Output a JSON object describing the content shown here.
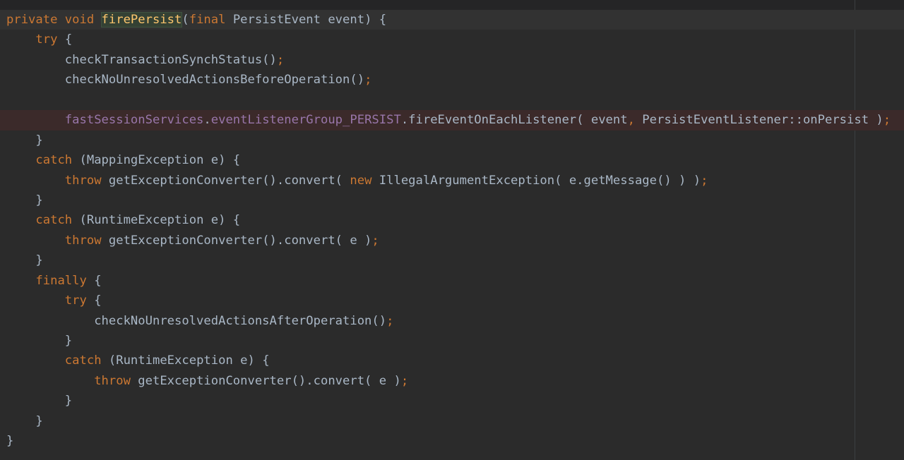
{
  "editor": {
    "colors": {
      "background": "#2b2b2b",
      "keyword": "#cc7832",
      "method_declaration": "#ffc66d",
      "field": "#9876aa",
      "plain": "#a9b7c6",
      "breakpoint_line": "#3b2a2a"
    },
    "lines": [
      {
        "indent": "",
        "tokens": [
          {
            "cls": "kw",
            "text": "private void "
          },
          {
            "cls": "caret",
            "text": ""
          },
          {
            "cls": "fn decl-hl",
            "text": "firePersist"
          },
          {
            "cls": "",
            "text": "("
          },
          {
            "cls": "kw",
            "text": "final "
          },
          {
            "cls": "",
            "text": "PersistEvent event) {"
          }
        ]
      },
      {
        "indent": "    ",
        "tokens": [
          {
            "cls": "kw",
            "text": "try "
          },
          {
            "cls": "",
            "text": "{"
          }
        ]
      },
      {
        "indent": "        ",
        "tokens": [
          {
            "cls": "",
            "text": "checkTransactionSynchStatus()"
          },
          {
            "cls": "pun",
            "text": ";"
          }
        ]
      },
      {
        "indent": "        ",
        "tokens": [
          {
            "cls": "",
            "text": "checkNoUnresolvedActionsBeforeOperation()"
          },
          {
            "cls": "pun",
            "text": ";"
          }
        ]
      },
      {
        "indent": "",
        "tokens": []
      },
      {
        "indent": "        ",
        "tokens": [
          {
            "cls": "fld",
            "text": "fastSessionServices"
          },
          {
            "cls": "",
            "text": "."
          },
          {
            "cls": "fld",
            "text": "eventListenerGroup_PERSIST"
          },
          {
            "cls": "",
            "text": ".fireEventOnEachListener( event"
          },
          {
            "cls": "pun",
            "text": ", "
          },
          {
            "cls": "",
            "text": "PersistEventListener::onPersist )"
          },
          {
            "cls": "pun",
            "text": ";"
          }
        ]
      },
      {
        "indent": "    ",
        "tokens": [
          {
            "cls": "",
            "text": "}"
          }
        ]
      },
      {
        "indent": "    ",
        "tokens": [
          {
            "cls": "kw",
            "text": "catch "
          },
          {
            "cls": "",
            "text": "(MappingException e) {"
          }
        ]
      },
      {
        "indent": "        ",
        "tokens": [
          {
            "cls": "kw",
            "text": "throw "
          },
          {
            "cls": "",
            "text": "getExceptionConverter().convert( "
          },
          {
            "cls": "kw",
            "text": "new "
          },
          {
            "cls": "",
            "text": "IllegalArgumentException( e.getMessage() ) )"
          },
          {
            "cls": "pun",
            "text": ";"
          }
        ]
      },
      {
        "indent": "    ",
        "tokens": [
          {
            "cls": "",
            "text": "}"
          }
        ]
      },
      {
        "indent": "    ",
        "tokens": [
          {
            "cls": "kw",
            "text": "catch "
          },
          {
            "cls": "",
            "text": "(RuntimeException e) {"
          }
        ]
      },
      {
        "indent": "        ",
        "tokens": [
          {
            "cls": "kw",
            "text": "throw "
          },
          {
            "cls": "",
            "text": "getExceptionConverter().convert( e )"
          },
          {
            "cls": "pun",
            "text": ";"
          }
        ]
      },
      {
        "indent": "    ",
        "tokens": [
          {
            "cls": "",
            "text": "}"
          }
        ]
      },
      {
        "indent": "    ",
        "tokens": [
          {
            "cls": "kw",
            "text": "finally "
          },
          {
            "cls": "",
            "text": "{"
          }
        ]
      },
      {
        "indent": "        ",
        "tokens": [
          {
            "cls": "kw",
            "text": "try "
          },
          {
            "cls": "",
            "text": "{"
          }
        ]
      },
      {
        "indent": "            ",
        "tokens": [
          {
            "cls": "",
            "text": "checkNoUnresolvedActionsAfterOperation()"
          },
          {
            "cls": "pun",
            "text": ";"
          }
        ]
      },
      {
        "indent": "        ",
        "tokens": [
          {
            "cls": "",
            "text": "}"
          }
        ]
      },
      {
        "indent": "        ",
        "tokens": [
          {
            "cls": "kw",
            "text": "catch "
          },
          {
            "cls": "",
            "text": "(RuntimeException e) {"
          }
        ]
      },
      {
        "indent": "            ",
        "tokens": [
          {
            "cls": "kw",
            "text": "throw "
          },
          {
            "cls": "",
            "text": "getExceptionConverter().convert( e )"
          },
          {
            "cls": "pun",
            "text": ";"
          }
        ]
      },
      {
        "indent": "        ",
        "tokens": [
          {
            "cls": "",
            "text": "}"
          }
        ]
      },
      {
        "indent": "    ",
        "tokens": [
          {
            "cls": "",
            "text": "}"
          }
        ]
      },
      {
        "indent": "",
        "tokens": [
          {
            "cls": "",
            "text": "}"
          }
        ]
      }
    ]
  }
}
